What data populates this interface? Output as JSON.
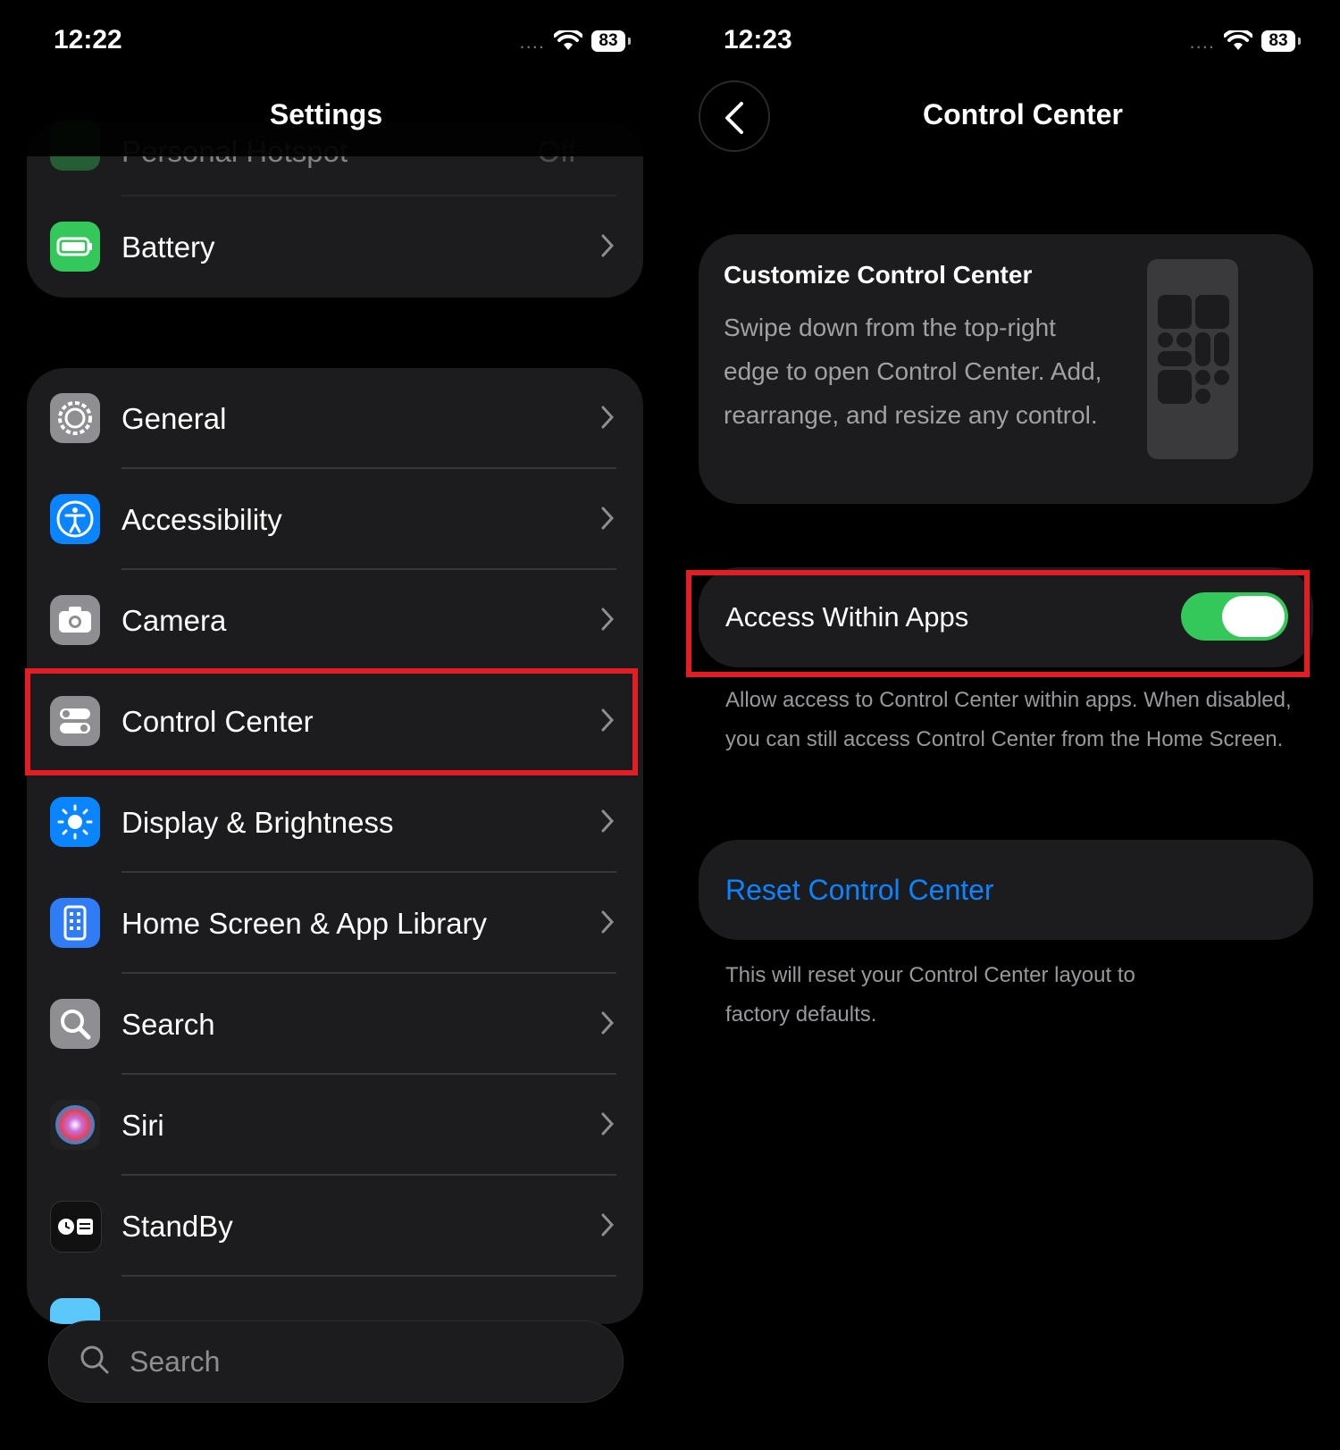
{
  "left": {
    "status": {
      "time": "12:22",
      "dots": "....",
      "battery": "83"
    },
    "title": "Settings",
    "top_group": [
      {
        "label": "Personal Hotspot",
        "value": "Off",
        "icon": "hotspot-icon",
        "color": "#30b050"
      },
      {
        "label": "Battery",
        "icon": "battery-icon",
        "color": "#34c759"
      }
    ],
    "main_group": [
      {
        "label": "General",
        "icon": "gear-icon",
        "color": "#8e8e93"
      },
      {
        "label": "Accessibility",
        "icon": "accessibility-icon",
        "color": "#0a84ff"
      },
      {
        "label": "Camera",
        "icon": "camera-icon",
        "color": "#8e8e93"
      },
      {
        "label": "Control Center",
        "icon": "control-center-icon",
        "color": "#8e8e93"
      },
      {
        "label": "Display & Brightness",
        "icon": "sun-icon",
        "color": "#0a84ff"
      },
      {
        "label": "Home Screen & App Library",
        "icon": "home-screen-icon",
        "color": "#2f7cf6"
      },
      {
        "label": "Search",
        "icon": "search-icon",
        "color": "#8e8e93"
      },
      {
        "label": "Siri",
        "icon": "siri-icon",
        "color": "#222"
      },
      {
        "label": "StandBy",
        "icon": "standby-icon",
        "color": "#111"
      }
    ],
    "search": {
      "placeholder": "Search"
    }
  },
  "right": {
    "status": {
      "time": "12:23",
      "dots": "....",
      "battery": "83"
    },
    "title": "Control Center",
    "customize": {
      "title": "Customize Control Center",
      "body": "Swipe down from the top-right edge to open Control Center. Add, rearrange, and resize any control."
    },
    "access": {
      "label": "Access Within Apps",
      "enabled": true,
      "footnote": "Allow access to Control Center within apps. When disabled, you can still access Control Center from the Home Screen."
    },
    "reset": {
      "label": "Reset Control Center",
      "footnote": "This will reset your Control Center layout to factory defaults."
    }
  },
  "colors": {
    "highlight": "#e11d25",
    "accent": "#0a84ff",
    "toggle_on": "#34c759"
  }
}
